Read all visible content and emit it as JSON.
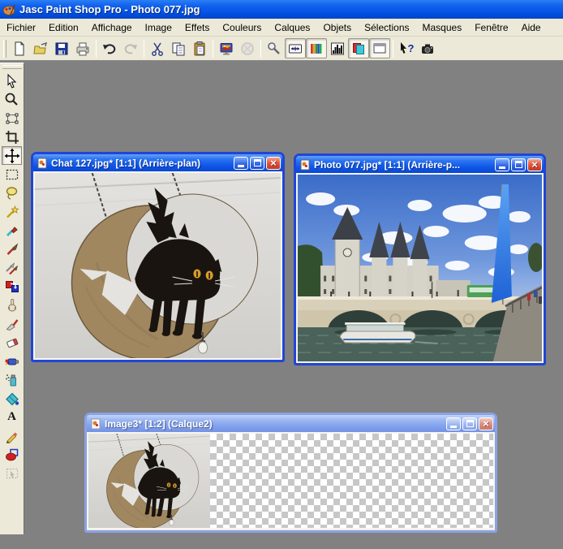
{
  "app": {
    "title": "Jasc Paint Shop Pro - Photo 077.jpg"
  },
  "menu": {
    "items": [
      "Fichier",
      "Edition",
      "Affichage",
      "Image",
      "Effets",
      "Couleurs",
      "Calques",
      "Objets",
      "Sélections",
      "Masques",
      "Fenêtre",
      "Aide"
    ]
  },
  "toolbar": {
    "help_glyph": "?",
    "buttons": [
      {
        "name": "new",
        "enabled": true
      },
      {
        "name": "open",
        "enabled": true
      },
      {
        "name": "save",
        "enabled": true
      },
      {
        "name": "print",
        "enabled": true
      },
      {
        "name": "undo",
        "enabled": true
      },
      {
        "name": "redo",
        "enabled": false
      },
      {
        "name": "cut",
        "enabled": true
      },
      {
        "name": "copy",
        "enabled": true
      },
      {
        "name": "paste",
        "enabled": true
      },
      {
        "name": "full-screen-preview",
        "enabled": true
      },
      {
        "name": "acquire",
        "enabled": false
      },
      {
        "name": "toggle-tool-palette",
        "enabled": true,
        "pressed": false
      },
      {
        "name": "toggle-tool-options",
        "enabled": true,
        "pressed": true
      },
      {
        "name": "toggle-color-palette",
        "enabled": true,
        "pressed": true
      },
      {
        "name": "toggle-histogram",
        "enabled": true,
        "pressed": false
      },
      {
        "name": "toggle-layer-palette",
        "enabled": true,
        "pressed": true
      },
      {
        "name": "toggle-overview",
        "enabled": true,
        "pressed": true
      },
      {
        "name": "context-help",
        "enabled": true
      },
      {
        "name": "screen-capture",
        "enabled": true
      }
    ]
  },
  "tool_palette": {
    "selected": "mover",
    "text_tool_glyph": "A",
    "tools": [
      "arrow",
      "zoom",
      "deformation",
      "crop",
      "mover",
      "selection",
      "freehand-selection",
      "magic-wand",
      "dropper",
      "paintbrush",
      "clone-brush",
      "color-replacer",
      "retouch",
      "scratch-remover",
      "eraser",
      "picture-tube",
      "airbrush",
      "flood-fill",
      "text",
      "draw",
      "preset-shapes",
      "object-selector"
    ]
  },
  "windows": [
    {
      "title": "Chat 127.jpg* [1:1] (Arrière-plan)",
      "active": true,
      "content": "hanging metal sign: black cat with yellow eyes standing on a tan crescent moon, grey ceiling background"
    },
    {
      "title": "Photo 077.jpg* [1:1] (Arrière-p...",
      "active": true,
      "content": "Paris: Conciergerie towers, Pont au Change bridge over the Seine, white tour boat, tall blue banner at right, cloudy blue sky"
    },
    {
      "title": "Image3* [1:2] (Calque2)",
      "active": false,
      "content": "cat sign image at half zoom on left, transparent checkerboard on right"
    }
  ],
  "colors": {
    "titlebar_blue": "#0a52e2",
    "menu_bg": "#ece9d8",
    "workspace_grey": "#818181",
    "active_frame": "#2046d4",
    "inactive_frame": "#8ba1e4",
    "close_red": "#e0543a",
    "checker_grey": "#c7c7c7"
  }
}
